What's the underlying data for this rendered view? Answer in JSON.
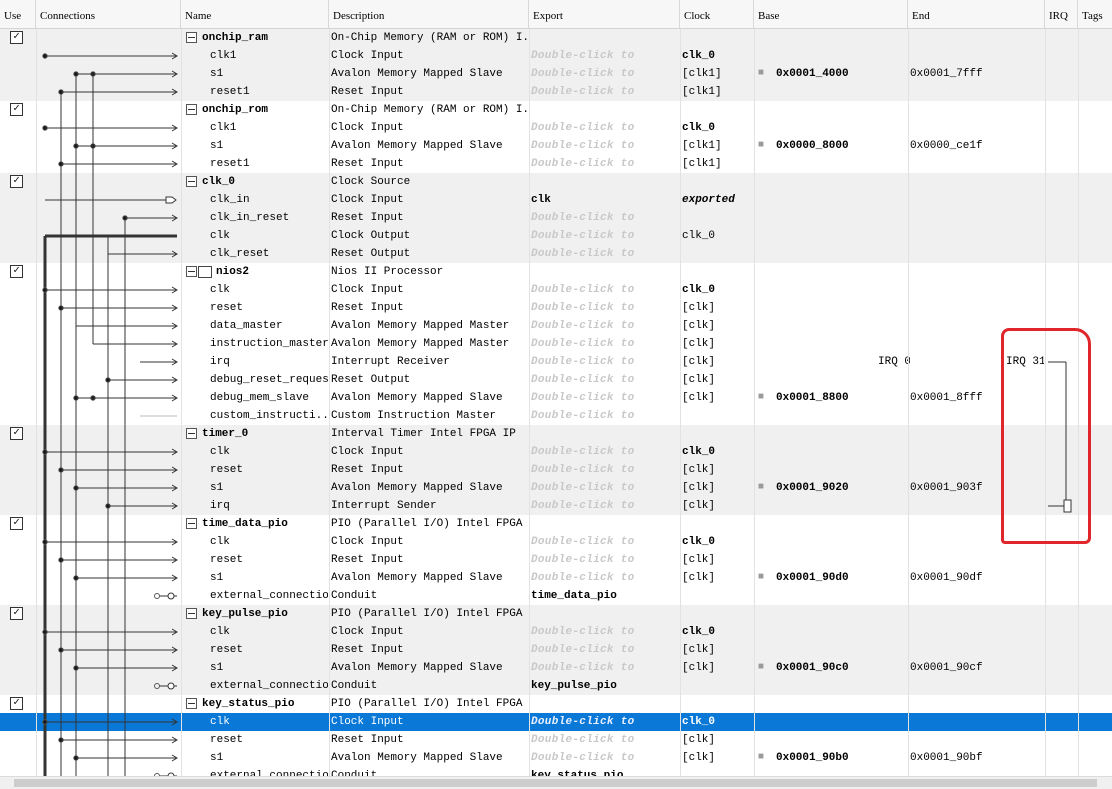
{
  "columns": [
    "Use",
    "Connections",
    "Name",
    "Description",
    "Export",
    "Clock",
    "Base",
    "End",
    "IRQ",
    "Tags"
  ],
  "export_hint": "Double-click to",
  "rows": [
    {
      "kind": "head",
      "name": "onchip_ram",
      "desc": "On-Chip Memory (RAM or ROM) I...",
      "g": 1
    },
    {
      "kind": "port",
      "name": "clk1",
      "desc": "Clock Input",
      "export": "",
      "clock": "clk_0",
      "clock_style": "bold",
      "g": 1
    },
    {
      "kind": "port",
      "name": "s1",
      "desc": "Avalon Memory Mapped Slave",
      "export": "",
      "clock": "[clk1]",
      "base": "0x0001_4000",
      "end": "0x0001_7fff",
      "g": 1
    },
    {
      "kind": "port",
      "name": "reset1",
      "desc": "Reset Input",
      "export": "",
      "clock": "[clk1]",
      "g": 1
    },
    {
      "kind": "head",
      "name": "onchip_rom",
      "desc": "On-Chip Memory (RAM or ROM) I...",
      "g": 0
    },
    {
      "kind": "port",
      "name": "clk1",
      "desc": "Clock Input",
      "export": "",
      "clock": "clk_0",
      "clock_style": "bold",
      "g": 0
    },
    {
      "kind": "port",
      "name": "s1",
      "desc": "Avalon Memory Mapped Slave",
      "export": "",
      "clock": "[clk1]",
      "base": "0x0000_8000",
      "end": "0x0000_ce1f",
      "g": 0
    },
    {
      "kind": "port",
      "name": "reset1",
      "desc": "Reset Input",
      "export": "",
      "clock": "[clk1]",
      "g": 0
    },
    {
      "kind": "head",
      "name": "clk_0",
      "desc": "Clock Source",
      "g": 1
    },
    {
      "kind": "port",
      "name": "clk_in",
      "desc": "Clock Input",
      "export_value": "clk",
      "clock": "exported",
      "clock_style": "bolditalic",
      "g": 1
    },
    {
      "kind": "port",
      "name": "clk_in_reset",
      "desc": "Reset Input",
      "export": "",
      "g": 1
    },
    {
      "kind": "port",
      "name": "clk",
      "desc": "Clock Output",
      "export": "",
      "clock": "clk_0",
      "g": 1
    },
    {
      "kind": "port",
      "name": "clk_reset",
      "desc": "Reset Output",
      "export": "",
      "g": 1
    },
    {
      "kind": "head",
      "name": "nios2",
      "desc": "Nios II Processor",
      "icon": true,
      "g": 0
    },
    {
      "kind": "port",
      "name": "clk",
      "desc": "Clock Input",
      "export": "",
      "clock": "clk_0",
      "clock_style": "bold",
      "g": 0
    },
    {
      "kind": "port",
      "name": "reset",
      "desc": "Reset Input",
      "export": "",
      "clock": "[clk]",
      "g": 0
    },
    {
      "kind": "port",
      "name": "data_master",
      "desc": "Avalon Memory Mapped Master",
      "export": "",
      "clock": "[clk]",
      "g": 0
    },
    {
      "kind": "port",
      "name": "instruction_master",
      "desc": "Avalon Memory Mapped Master",
      "export": "",
      "clock": "[clk]",
      "g": 0
    },
    {
      "kind": "port",
      "name": "irq",
      "desc": "Interrupt Receiver",
      "export": "",
      "clock": "[clk]",
      "irq_left": "IRQ 0",
      "irq_right": "IRQ 31",
      "g": 0
    },
    {
      "kind": "port",
      "name": "debug_reset_request",
      "desc": "Reset Output",
      "export": "",
      "clock": "[clk]",
      "g": 0
    },
    {
      "kind": "port",
      "name": "debug_mem_slave",
      "desc": "Avalon Memory Mapped Slave",
      "export": "",
      "clock": "[clk]",
      "base": "0x0001_8800",
      "end": "0x0001_8fff",
      "g": 0
    },
    {
      "kind": "port",
      "name": "custom_instructi...",
      "desc": "Custom Instruction Master",
      "export": "",
      "g": 0
    },
    {
      "kind": "head",
      "name": "timer_0",
      "desc": "Interval Timer Intel FPGA IP",
      "g": 1
    },
    {
      "kind": "port",
      "name": "clk",
      "desc": "Clock Input",
      "export": "",
      "clock": "clk_0",
      "clock_style": "bold",
      "g": 1
    },
    {
      "kind": "port",
      "name": "reset",
      "desc": "Reset Input",
      "export": "",
      "clock": "[clk]",
      "g": 1
    },
    {
      "kind": "port",
      "name": "s1",
      "desc": "Avalon Memory Mapped Slave",
      "export": "",
      "clock": "[clk]",
      "base": "0x0001_9020",
      "end": "0x0001_903f",
      "g": 1
    },
    {
      "kind": "port",
      "name": "irq",
      "desc": "Interrupt Sender",
      "export": "",
      "clock": "[clk]",
      "g": 1
    },
    {
      "kind": "head",
      "name": "time_data_pio",
      "desc": "PIO (Parallel I/O) Intel FPGA IP",
      "g": 0
    },
    {
      "kind": "port",
      "name": "clk",
      "desc": "Clock Input",
      "export": "",
      "clock": "clk_0",
      "clock_style": "bold",
      "g": 0
    },
    {
      "kind": "port",
      "name": "reset",
      "desc": "Reset Input",
      "export": "",
      "clock": "[clk]",
      "g": 0
    },
    {
      "kind": "port",
      "name": "s1",
      "desc": "Avalon Memory Mapped Slave",
      "export": "",
      "clock": "[clk]",
      "base": "0x0001_90d0",
      "end": "0x0001_90df",
      "g": 0
    },
    {
      "kind": "port",
      "name": "external_connection",
      "desc": "Conduit",
      "export_value": "time_data_pio",
      "g": 0
    },
    {
      "kind": "head",
      "name": "key_pulse_pio",
      "desc": "PIO (Parallel I/O) Intel FPGA IP",
      "g": 1
    },
    {
      "kind": "port",
      "name": "clk",
      "desc": "Clock Input",
      "export": "",
      "clock": "clk_0",
      "clock_style": "bold",
      "g": 1
    },
    {
      "kind": "port",
      "name": "reset",
      "desc": "Reset Input",
      "export": "",
      "clock": "[clk]",
      "g": 1
    },
    {
      "kind": "port",
      "name": "s1",
      "desc": "Avalon Memory Mapped Slave",
      "export": "",
      "clock": "[clk]",
      "base": "0x0001_90c0",
      "end": "0x0001_90cf",
      "g": 1
    },
    {
      "kind": "port",
      "name": "external_connection",
      "desc": "Conduit",
      "export_value": "key_pulse_pio",
      "g": 1
    },
    {
      "kind": "head",
      "name": "key_status_pio",
      "desc": "PIO (Parallel I/O) Intel FPGA IP",
      "g": 0
    },
    {
      "kind": "port",
      "name": "clk",
      "desc": "Clock Input",
      "export": "",
      "clock": "clk_0",
      "clock_style": "bold",
      "selected": true,
      "g": 0
    },
    {
      "kind": "port",
      "name": "reset",
      "desc": "Reset Input",
      "export": "",
      "clock": "[clk]",
      "g": 0
    },
    {
      "kind": "port",
      "name": "s1",
      "desc": "Avalon Memory Mapped Slave",
      "export": "",
      "clock": "[clk]",
      "base": "0x0001_90b0",
      "end": "0x0001_90bf",
      "g": 0
    },
    {
      "kind": "port",
      "name": "external_connection",
      "desc": "Conduit",
      "export_value": "key_status_pio",
      "g": 0
    }
  ]
}
